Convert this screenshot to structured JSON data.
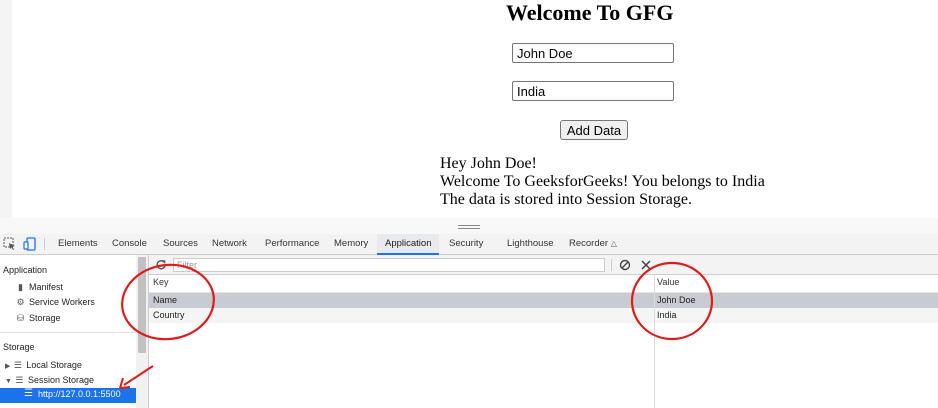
{
  "page": {
    "title": "Welcome To GFG",
    "name_value": "John Doe",
    "country_value": "India",
    "add_button": "Add Data",
    "message_line1": "Hey John Doe!",
    "message_line2": "Welcome To GeeksforGeeks! You belongs to India",
    "message_line3": "The data is stored into Session Storage."
  },
  "devtools": {
    "tabs": [
      "Elements",
      "Console",
      "Sources",
      "Network",
      "Performance",
      "Memory",
      "Application",
      "Security",
      "Lighthouse",
      "Recorder"
    ],
    "active_tab": "Application",
    "sidebar": {
      "application_header": "Application",
      "manifest": "Manifest",
      "service_workers": "Service Workers",
      "storage_item": "Storage",
      "storage_header": "Storage",
      "local_storage": "Local Storage",
      "session_storage": "Session Storage",
      "session_origin": "http://127.0.0.1:5500"
    },
    "filter_placeholder": "Filter",
    "table": {
      "key_header": "Key",
      "value_header": "Value",
      "rows": [
        {
          "key": "Name",
          "value": "John Doe"
        },
        {
          "key": "Country",
          "value": "India"
        }
      ]
    }
  },
  "colors": {
    "accent": "#1a73e8",
    "annotation_red": "#e0191a",
    "selected_row": "#c8cbd1"
  }
}
